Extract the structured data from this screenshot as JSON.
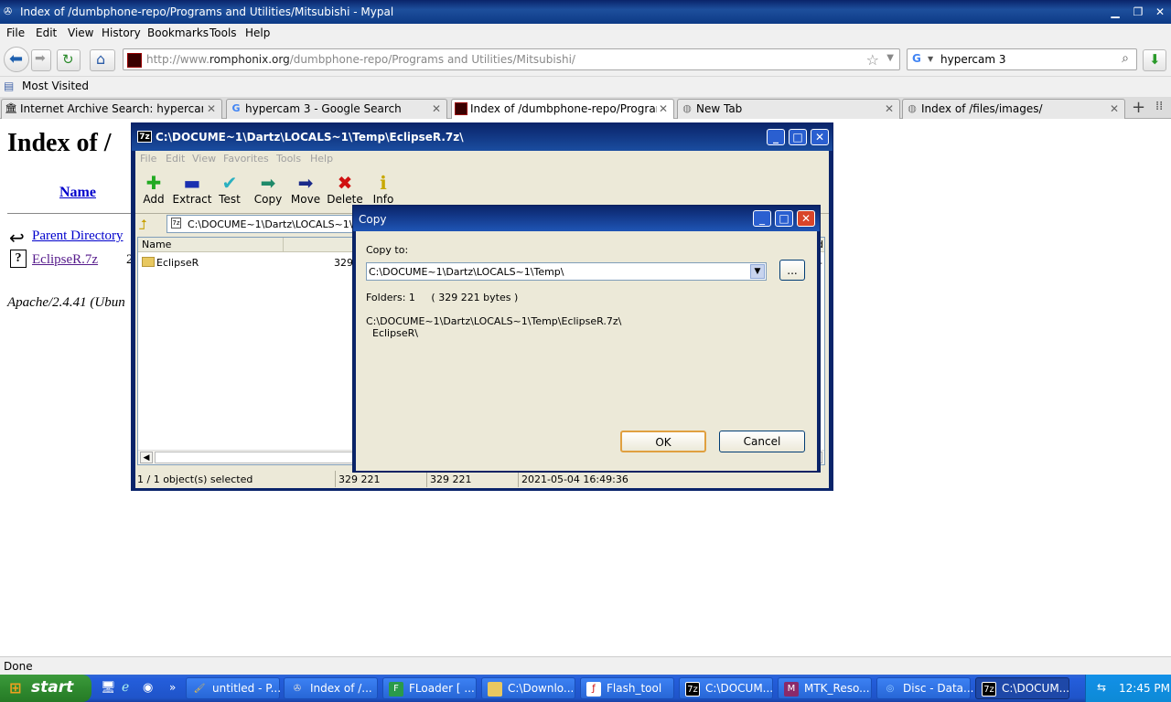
{
  "browser": {
    "title": "Index of /dumbphone-repo/Programs and Utilities/Mitsubishi - Mypal",
    "menu": [
      "File",
      "Edit",
      "View",
      "History",
      "Bookmarks",
      "Tools",
      "Help"
    ],
    "url_prefix": "http://www.",
    "url_domain": "romphonix.org",
    "url_path": "/dumbphone-repo/Programs and Utilities/Mitsubishi/",
    "search_value": "hypercam 3",
    "bookmark": "Most Visited",
    "tabs": [
      {
        "label": "Internet Archive Search: hypercam 3"
      },
      {
        "label": "hypercam 3 - Google Search"
      },
      {
        "label": "Index of /dumbphone-repo/Programs and..."
      },
      {
        "label": "New Tab"
      },
      {
        "label": "Index of /files/images/"
      }
    ],
    "status": "Done"
  },
  "page": {
    "heading": "Index of /",
    "col_name": "Name",
    "parent": "Parent Directory",
    "file": "EclipseR.7z",
    "file_partial": "2",
    "footer": "Apache/2.4.41 (Ubun"
  },
  "sevenzip": {
    "title": "C:\\DOCUME~1\\Dartz\\LOCALS~1\\Temp\\EclipseR.7z\\",
    "menu": [
      "File",
      "Edit",
      "View",
      "Favorites",
      "Tools",
      "Help"
    ],
    "tools": [
      "Add",
      "Extract",
      "Test",
      "Copy",
      "Move",
      "Delete",
      "Info"
    ],
    "path": "C:\\DOCUME~1\\Dartz\\LOCALS~1\\Te",
    "col_name": "Name",
    "col_right": "d",
    "row_name": "EclipseR",
    "row_size": "329",
    "row_right": "-",
    "status": [
      "1 / 1 object(s) selected",
      "329 221",
      "329 221",
      "2021-05-04 16:49:36"
    ]
  },
  "dialog": {
    "title": "Copy",
    "copy_to_label": "Copy to:",
    "copy_to_value": "C:\\DOCUME~1\\Dartz\\LOCALS~1\\Temp\\",
    "browse": "...",
    "folders": "Folders: 1     ( 329 221 bytes )",
    "src_line1": "C:\\DOCUME~1\\Dartz\\LOCALS~1\\Temp\\EclipseR.7z\\",
    "src_line2": "EclipseR\\",
    "ok": "OK",
    "cancel": "Cancel"
  },
  "taskbar": {
    "start": "start",
    "items": [
      {
        "label": "untitled - P..."
      },
      {
        "label": "Index of /..."
      },
      {
        "label": "FLoader [ ..."
      },
      {
        "label": "C:\\Downlo..."
      },
      {
        "label": "Flash_tool"
      },
      {
        "label": "C:\\DOCUM..."
      },
      {
        "label": "MTK_Reso..."
      },
      {
        "label": "Disc - Data..."
      },
      {
        "label": "C:\\DOCUM..."
      }
    ],
    "clock": "12:45 PM"
  }
}
